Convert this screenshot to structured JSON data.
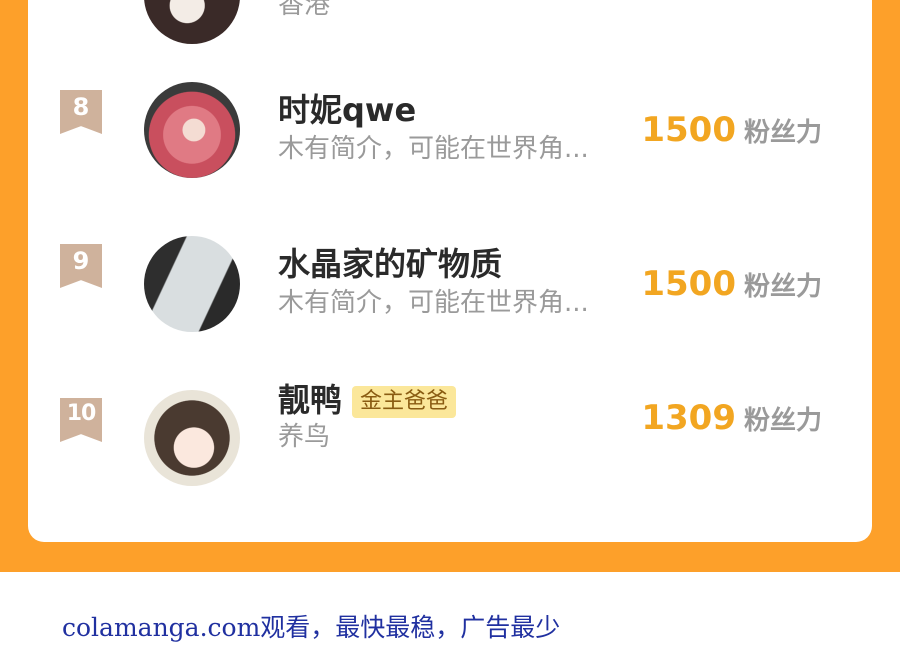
{
  "prev_entry": {
    "bio": "香港"
  },
  "entries": [
    {
      "rank": "8",
      "name": "时妮qwe",
      "bio": "木有简介，可能在世界角...",
      "score": "1500",
      "unit": "粉丝力"
    },
    {
      "rank": "9",
      "name": "水晶家的矿物质",
      "bio": "木有简介，可能在世界角...",
      "score": "1500",
      "unit": "粉丝力"
    },
    {
      "rank": "10",
      "name": "靓鸭",
      "tag": "金主爸爸",
      "bio": "养鸟",
      "score": "1309",
      "unit": "粉丝力"
    }
  ],
  "footer": {
    "text": "colamanga.com观看，最快最稳，广告最少"
  },
  "colors": {
    "orange": "#fda02a",
    "gold": "#f2a621",
    "badge": "#cfb29c"
  },
  "icons": [
    "rank-ribbon-icon",
    "avatar-image"
  ]
}
